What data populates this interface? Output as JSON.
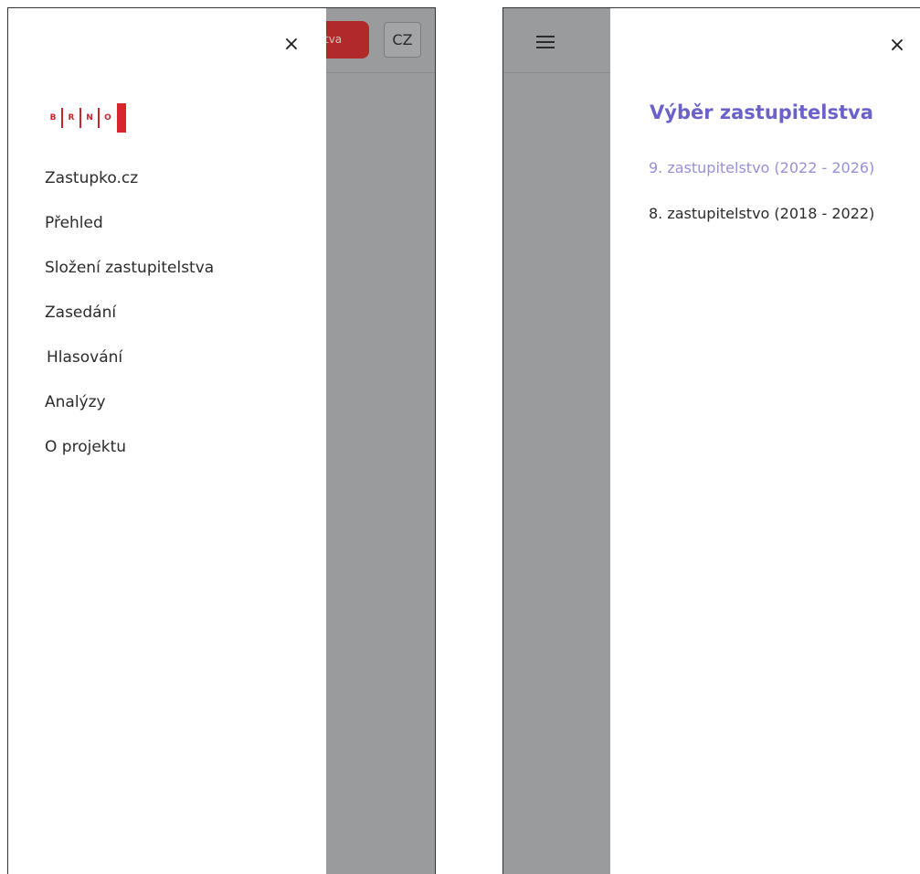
{
  "left_panel": {
    "background_button_partial": "tva",
    "language_button": "CZ",
    "close_glyph": "×",
    "logo": {
      "letters": [
        "B",
        "R",
        "N",
        "O"
      ],
      "color": "#c8252c"
    },
    "menu": [
      {
        "label": "Zastupko.cz"
      },
      {
        "label": "Přehled"
      },
      {
        "label": "Složení zastupitelstva"
      },
      {
        "label": "Zasedání"
      },
      {
        "label": "Hlasování"
      },
      {
        "label": "Analýzy"
      },
      {
        "label": "O projektu"
      }
    ]
  },
  "right_panel": {
    "menu_icon": "hamburger-icon",
    "close_glyph": "×",
    "title": "Výběr zastupitelstva",
    "accent_color": "#6a62c8",
    "terms": [
      {
        "label": "9. zastupitelstvo (2022 - 2026)",
        "selected": true
      },
      {
        "label": "8. zastupitelstvo (2018 - 2022)",
        "selected": false
      }
    ]
  }
}
